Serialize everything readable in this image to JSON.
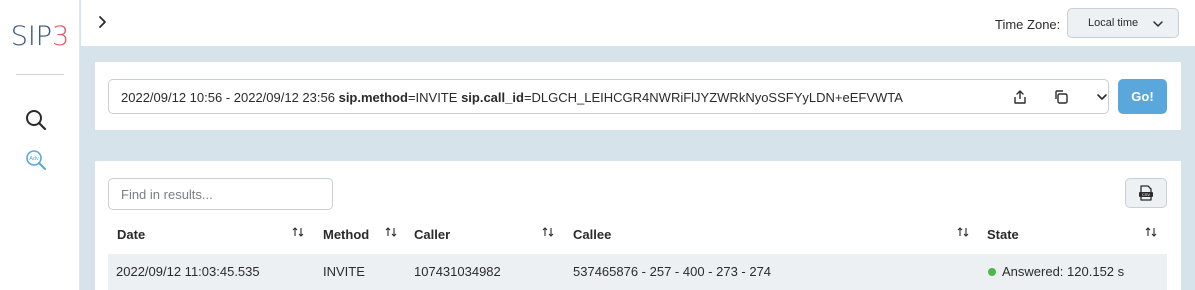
{
  "logo": {
    "sp": "SIP",
    "three": "3"
  },
  "nav": [
    {
      "icon": "search-icon"
    },
    {
      "icon": "advanced-search-icon",
      "badge": "Adv"
    }
  ],
  "topbar": {
    "expand_icon": "chevron-right-icon",
    "timezone_label": "Time Zone:",
    "timezone_value": "Local time"
  },
  "search": {
    "range": "2022/09/12 10:56 - 2022/09/12 23:56",
    "term1_key": "sip.method",
    "term1_val": "=INVITE",
    "term2_key": "sip.call_id",
    "term2_val": "=DLGCH_LEIHCGR4NWRiFlJYZWRkNyoSSFYyLDN+eEFVWTA",
    "go_label": "Go!",
    "icons": [
      "share-icon",
      "copy-icon",
      "chevron-down-icon"
    ]
  },
  "results": {
    "find_placeholder": "Find in results...",
    "export_icon": "csv-export-icon",
    "columns": [
      "Date",
      "Method",
      "Caller",
      "Callee",
      "State"
    ],
    "rows": [
      {
        "date": "2022/09/12 11:03:45.535",
        "method": "INVITE",
        "caller": "107431034982",
        "callee": "537465876 - 257 - 400 - 273 - 274",
        "state": "Answered: 120.152 s"
      }
    ]
  },
  "colors": {
    "accent": "#5aa7dc",
    "logo_blue": "#35547a",
    "logo_red": "#e05a60",
    "status_answered": "#4cb84c",
    "background": "#d6e3eb"
  }
}
